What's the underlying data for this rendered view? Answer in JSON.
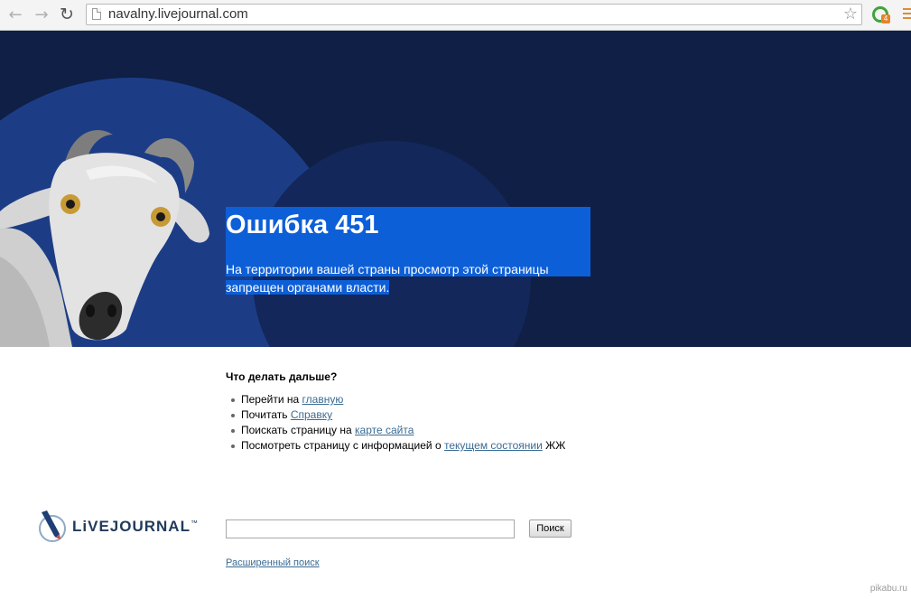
{
  "browser": {
    "url": "navalny.livejournal.com",
    "back_icon": "←",
    "forward_icon": "→",
    "reload_icon": "↻",
    "star_icon": "☆",
    "extension_badge": "4"
  },
  "hero": {
    "title": "Ошибка 451",
    "message_line1": "На территории вашей страны просмотр этой страницы",
    "message_line2": "запрещен органами власти."
  },
  "next": {
    "heading": "Что делать дальше?",
    "items": [
      {
        "prefix": "Перейти на ",
        "link": "главную",
        "suffix": ""
      },
      {
        "prefix": "Почитать ",
        "link": "Справку",
        "suffix": ""
      },
      {
        "prefix": "Поискать страницу на ",
        "link": "карте сайта",
        "suffix": ""
      },
      {
        "prefix": "Посмотреть страницу с информацией о ",
        "link": "текущем состоянии",
        "suffix": " ЖЖ"
      }
    ]
  },
  "logo": {
    "text": "LiVEJOURNAL",
    "trademark": "™"
  },
  "search": {
    "value": "",
    "button_label": "Поиск",
    "advanced_link": "Расширенный поиск"
  },
  "watermark": "pikabu.ru"
}
